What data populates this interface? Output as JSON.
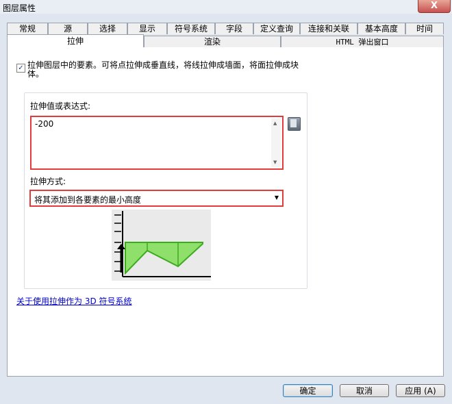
{
  "window": {
    "title": "图层属性",
    "close_label": "X"
  },
  "tabs_back": [
    "常规",
    "源",
    "选择",
    "显示",
    "符号系统",
    "字段",
    "定义查询",
    "连接和关联",
    "基本高度",
    "时间"
  ],
  "tabs_front": [
    "拉伸",
    "渲染",
    "HTML 弹出窗口"
  ],
  "extrude": {
    "checkbox_mark": "✓",
    "checkbox_text": "拉伸图层中的要素。可将点拉伸成垂直线，将线拉伸成墙面，将面拉伸成块体。",
    "value_label": "拉伸值或表达式:",
    "value": "-200",
    "method_label": "拉伸方式:",
    "method_value": "将其添加到各要素的最小高度",
    "help_link": "关于使用拉伸作为 3D 符号系统"
  },
  "buttons": {
    "ok": "确定",
    "cancel": "取消",
    "apply": "应用 (A)"
  },
  "colors": {
    "accent_red": "#e23b3b",
    "diagram_green": "#8ee06b",
    "diagram_stroke": "#3cac1e"
  },
  "icons": {
    "calc": "calculator-icon",
    "dropdown": "chevron-down-icon"
  }
}
